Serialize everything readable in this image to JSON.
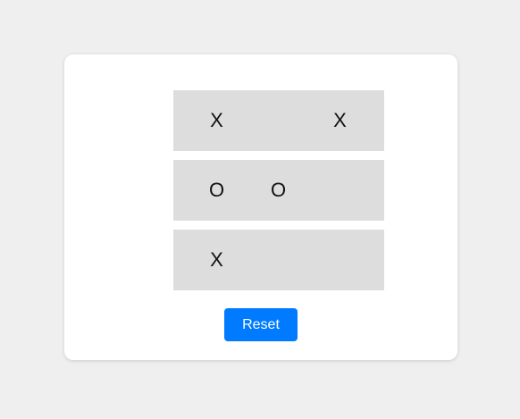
{
  "board": {
    "rows": [
      [
        "X",
        "",
        "X"
      ],
      [
        "O",
        "O",
        ""
      ],
      [
        "X",
        "",
        ""
      ]
    ]
  },
  "controls": {
    "reset_label": "Reset"
  },
  "colors": {
    "page_background": "#efefef",
    "card_background": "#ffffff",
    "row_background": "#dddddd",
    "button_background": "#007bff",
    "button_text": "#ffffff"
  }
}
